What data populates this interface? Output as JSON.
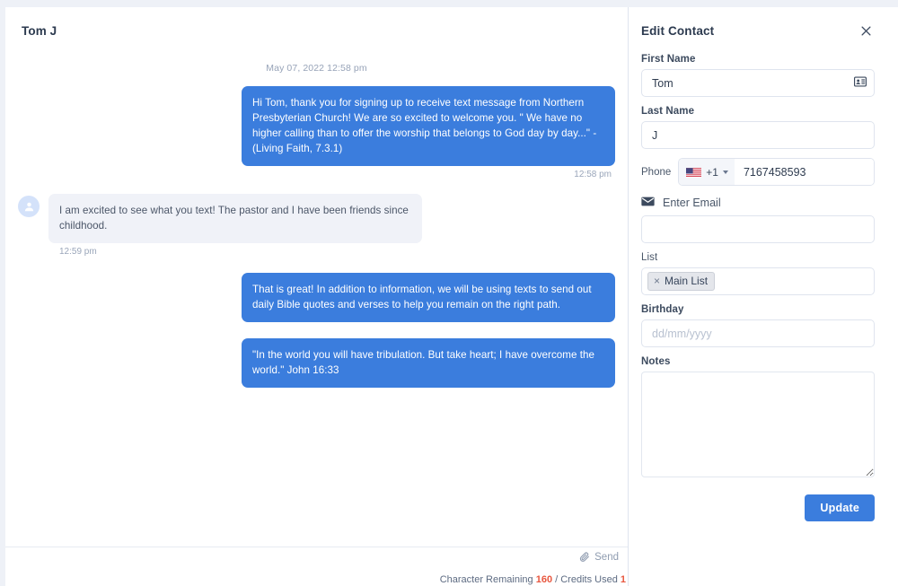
{
  "conversation": {
    "contact_name": "Tom J",
    "day_stamp": "May 07, 2022 12:58 pm",
    "avatar_icon": "user-avatar-icon",
    "messages": [
      {
        "direction": "out",
        "text": "Hi Tom, thank you for signing up to receive text message from Northern Presbyterian Church! We are so excited to welcome you. \" We have no higher calling than to offer the worship that belongs to God day by day...\" - (Living Faith, 7.3.1)",
        "time": "12:58 pm"
      },
      {
        "direction": "in",
        "text": "I am excited to see what you text! The pastor and I have been friends since childhood.",
        "time": "12:59 pm"
      },
      {
        "direction": "out",
        "text": "That is great! In addition to information, we will be using texts to send out daily Bible quotes and verses to help you remain on the right path.",
        "time": ""
      },
      {
        "direction": "out",
        "text": "\"In the world you will have tribulation. But take heart; I have overcome the world.\" John 16:33",
        "time": ""
      }
    ],
    "composer": {
      "attach_icon": "paperclip-icon",
      "send_label": "Send",
      "counter_prefix": "Character Remaining ",
      "counter_remaining": "160",
      "counter_middle": " / Credits Used ",
      "counter_credits": "1"
    }
  },
  "edit_panel": {
    "title": "Edit Contact",
    "close_icon": "close-icon",
    "first_name": {
      "label": "First Name",
      "value": "Tom",
      "placeholder": "",
      "icon": "contact-card-icon"
    },
    "last_name": {
      "label": "Last Name",
      "value": "J",
      "placeholder": ""
    },
    "phone": {
      "label": "Phone",
      "flag_icon": "us-flag-icon",
      "dial_code": "+1",
      "value": "7167458593",
      "placeholder": ""
    },
    "email": {
      "icon": "envelope-icon",
      "label": "Enter Email",
      "value": "",
      "placeholder": ""
    },
    "list": {
      "label": "List",
      "tags": [
        {
          "remove_glyph": "×",
          "label": "Main List"
        }
      ]
    },
    "birthday": {
      "label": "Birthday",
      "value": "",
      "placeholder": "dd/mm/yyyy"
    },
    "notes": {
      "label": "Notes",
      "value": "",
      "placeholder": ""
    },
    "update_label": "Update"
  },
  "colors": {
    "accent_blue": "#3b7ddd",
    "bubble_in_bg": "#f0f2f8",
    "counter_highlight": "#e8573f",
    "panel_bg": "#ffffff"
  }
}
